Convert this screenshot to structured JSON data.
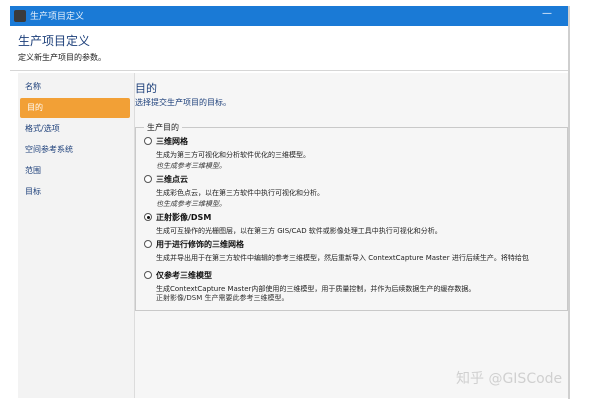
{
  "window": {
    "title": "生产项目定义",
    "minimize_glyph": "—"
  },
  "header": {
    "title": "生产项目定义",
    "subtitle": "定义新生产项目的参数。"
  },
  "sidebar": {
    "items": [
      {
        "label": "名称",
        "active": false
      },
      {
        "label": "目的",
        "active": true
      },
      {
        "label": "格式/选项",
        "active": false
      },
      {
        "label": "空间参考系统",
        "active": false
      },
      {
        "label": "范围",
        "active": false
      },
      {
        "label": "目标",
        "active": false
      }
    ]
  },
  "content": {
    "title": "目的",
    "subtitle": "选择提交生产项目的目标。",
    "group_label": "生产目的",
    "options": [
      {
        "label": "三维网格",
        "desc": "生成为第三方可视化和分析软件优化的三维模型。",
        "note": "也生成参考三维模型。",
        "checked": false
      },
      {
        "label": "三维点云",
        "desc": "生成彩色点云，以在第三方软件中执行可视化和分析。",
        "note": "也生成参考三维模型。",
        "checked": false
      },
      {
        "label": "正射影像/DSM",
        "desc": "生成可互操作的光栅图层，以在第三方 GIS/CAD 软件或影像处理工具中执行可视化和分析。",
        "note": "",
        "checked": true
      },
      {
        "label": "用于进行修饰的三维网格",
        "desc": "生成并导出用于在第三方软件中编辑的参考三维模型，然后重新导入 ContextCapture Master 进行后续生产。将特给包",
        "note": "",
        "checked": false
      },
      {
        "label": "仅参考三维模型",
        "desc": "生成ContextCapture Master内部使用的三维模型，用于质量控制，并作为后续数据生产的缓存数据。",
        "note": "正射影像/DSM 生产需要此参考三维模型。",
        "checked": false
      }
    ]
  },
  "watermark": "知乎 @GISCode"
}
